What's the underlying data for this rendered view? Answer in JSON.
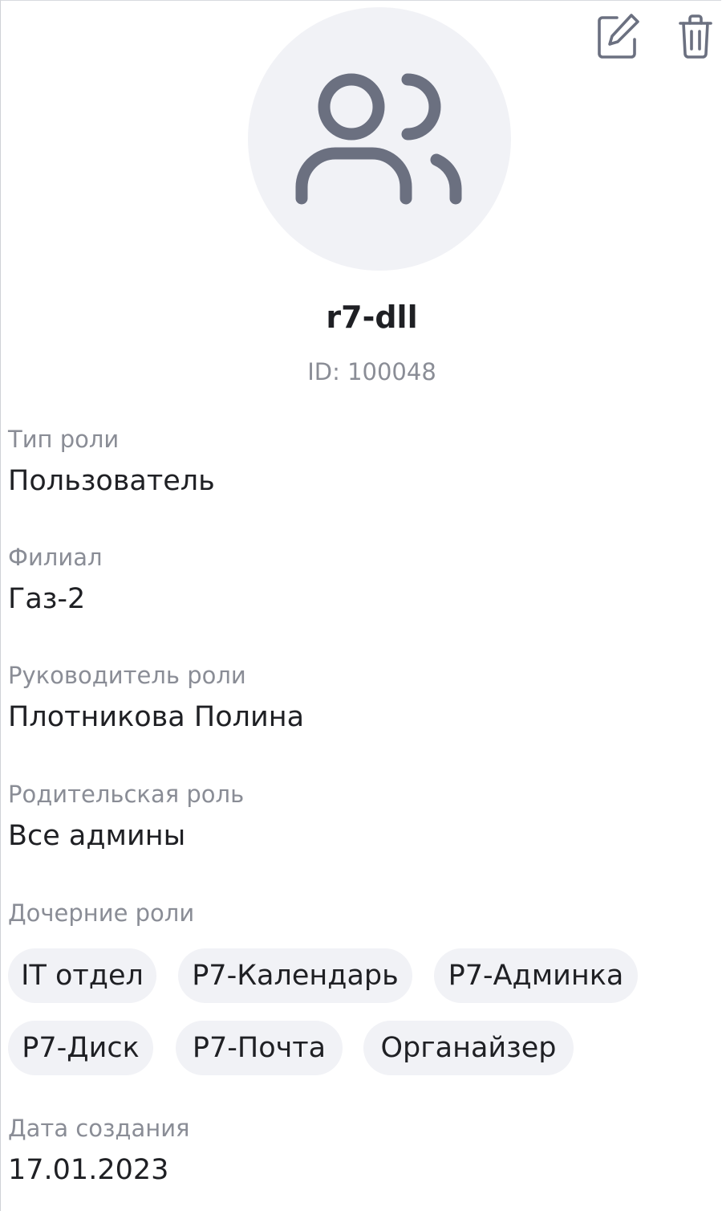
{
  "header": {
    "edit_icon": "pencil-square-icon",
    "delete_icon": "trash-icon"
  },
  "avatar": {
    "icon": "users-icon"
  },
  "role": {
    "name": "r7-dll",
    "id_label": "ID: 100048"
  },
  "fields": {
    "role_type": {
      "label": "Тип роли",
      "value": "Пользователь"
    },
    "branch": {
      "label": "Филиал",
      "value": "Газ-2"
    },
    "manager": {
      "label": "Руководитель роли",
      "value": "Плотникова Полина"
    },
    "parent_role": {
      "label": "Родительская роль",
      "value": "Все админы"
    },
    "child_roles": {
      "label": "Дочерние роли",
      "items": [
        "IT отдел",
        "Р7-Календарь",
        "Р7-Админка",
        "Р7-Диск",
        "Р7-Почта",
        "Органайзер"
      ]
    },
    "created": {
      "label": "Дата создания",
      "value": "17.01.2023"
    }
  },
  "colors": {
    "icon": "#6b7080",
    "chip_bg": "#f1f2f6",
    "avatar_bg": "#f1f2f6",
    "label": "#8a8d96",
    "text": "#1f2024"
  }
}
